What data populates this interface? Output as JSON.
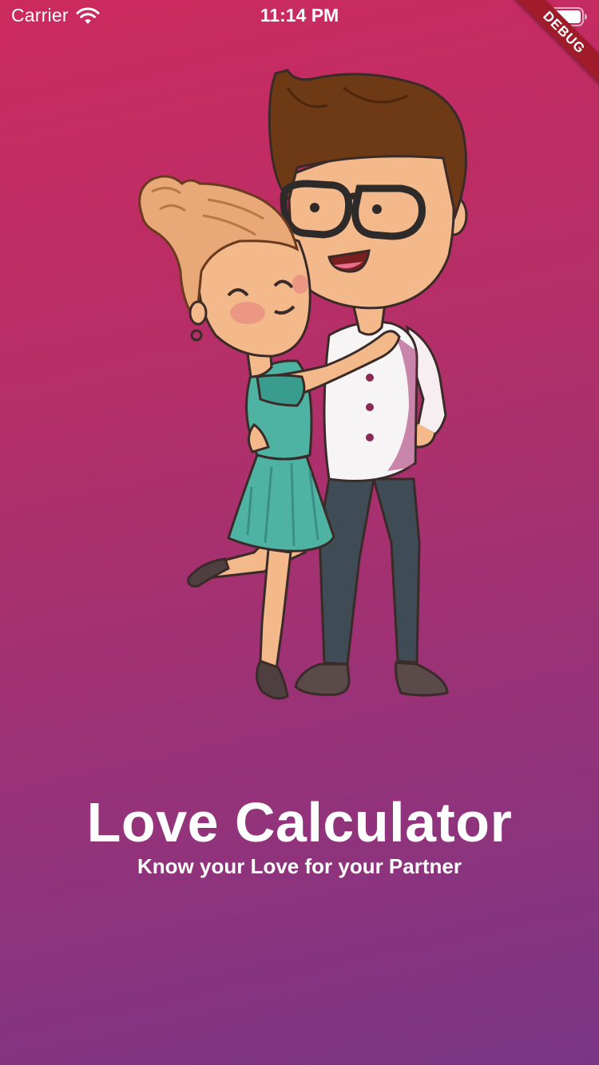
{
  "status_bar": {
    "carrier": "Carrier",
    "time": "11:14 PM",
    "wifi_icon": "wifi-icon",
    "battery_icon": "battery-icon"
  },
  "debug_banner": {
    "label": "DEBUG",
    "color": "#a11c2a"
  },
  "hero": {
    "illustration": "couple-hug-illustration"
  },
  "main": {
    "title": "Love Calculator",
    "subtitle": "Know your Love for your Partner"
  },
  "theme": {
    "gradient_top": "#cc2a5e",
    "gradient_bottom": "#7a3686",
    "text_color": "#ffffff"
  }
}
